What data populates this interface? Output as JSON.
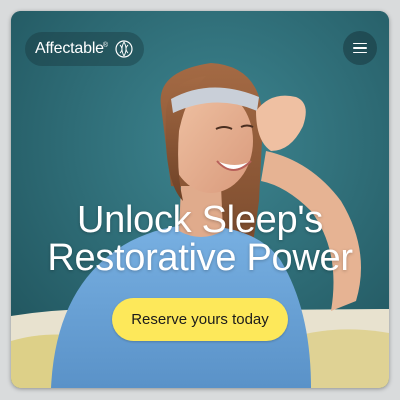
{
  "brand": {
    "name": "Affectable",
    "reg_mark": "®",
    "icon": "leaf-swirl-icon"
  },
  "header": {
    "menu_icon": "hamburger-menu-icon"
  },
  "hero": {
    "headline_line1": "Unlock Sleep's",
    "headline_line2": "Restorative Power",
    "cta_label": "Reserve yours today",
    "image": "woman-wearing-sleep-headband-photo"
  },
  "colors": {
    "cta": "#fde85a",
    "background": "#2e6a74",
    "shirt": "#6aa3d8"
  }
}
